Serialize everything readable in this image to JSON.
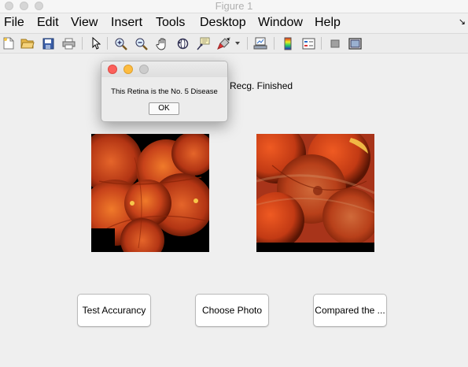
{
  "window": {
    "title": "Figure 1"
  },
  "menu": {
    "items": [
      "File",
      "Edit",
      "View",
      "Insert",
      "Tools",
      "Desktop",
      "Window",
      "Help"
    ],
    "overflow_arrow": "↘"
  },
  "toolbar": {
    "icons": [
      "new-figure-icon",
      "open-file-icon",
      "save-icon",
      "print-icon",
      "pointer-icon",
      "zoom-in-icon",
      "zoom-out-icon",
      "pan-icon",
      "rotate-3d-icon",
      "data-cursor-icon",
      "brush-icon",
      "brush-dropdown-icon",
      "link-plot-icon",
      "insert-colorbar-icon",
      "insert-legend-icon",
      "hide-plot-tools-icon",
      "show-plot-tools-icon"
    ]
  },
  "status": {
    "text": "Recg. Finished"
  },
  "buttons": {
    "test_accuracy": "Test Accurancy",
    "choose_photo": "Choose Photo",
    "compared": "Compared the ..."
  },
  "dialog": {
    "message": "This Retina is the No. 5 Disease",
    "ok_label": "OK",
    "close_color": "#fc605b",
    "minimize_color": "#fdbc40",
    "zoom_color": "#cccccc"
  },
  "colors": {
    "retina_dark": "#6e1a05",
    "retina_mid": "#c7421a",
    "retina_bright": "#f07a2a",
    "highlight": "#f6c64a"
  }
}
